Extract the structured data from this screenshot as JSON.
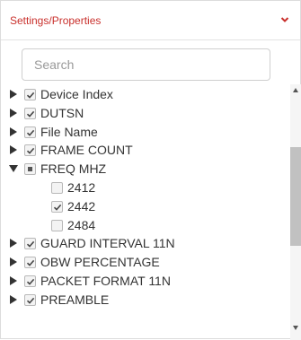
{
  "header": {
    "title": "Settings/Properties",
    "chevron_icon": "chevron-down-icon",
    "accent_color": "#c9302c"
  },
  "search": {
    "placeholder": "Search",
    "value": ""
  },
  "tree": {
    "items": [
      {
        "label": "Device Index",
        "state": "checked",
        "expanded": false
      },
      {
        "label": "DUTSN",
        "state": "checked",
        "expanded": false
      },
      {
        "label": "File Name",
        "state": "checked",
        "expanded": false
      },
      {
        "label": "FRAME COUNT",
        "state": "checked",
        "expanded": false
      },
      {
        "label": "FREQ MHZ",
        "state": "indeterminate",
        "expanded": true,
        "children": [
          {
            "label": "2412",
            "state": "unchecked"
          },
          {
            "label": "2442",
            "state": "checked"
          },
          {
            "label": "2484",
            "state": "unchecked"
          }
        ]
      },
      {
        "label": "GUARD INTERVAL 11N",
        "state": "checked",
        "expanded": false
      },
      {
        "label": "OBW PERCENTAGE",
        "state": "checked",
        "expanded": false
      },
      {
        "label": "PACKET FORMAT 11N",
        "state": "checked",
        "expanded": false
      },
      {
        "label": "PREAMBLE",
        "state": "checked",
        "expanded": false
      }
    ]
  },
  "icons": {
    "collapsed": "caret-right-icon",
    "expanded": "caret-down-icon",
    "check": "check-icon",
    "scroll_up": "scroll-up-arrow-icon",
    "scroll_down": "scroll-down-arrow-icon"
  }
}
